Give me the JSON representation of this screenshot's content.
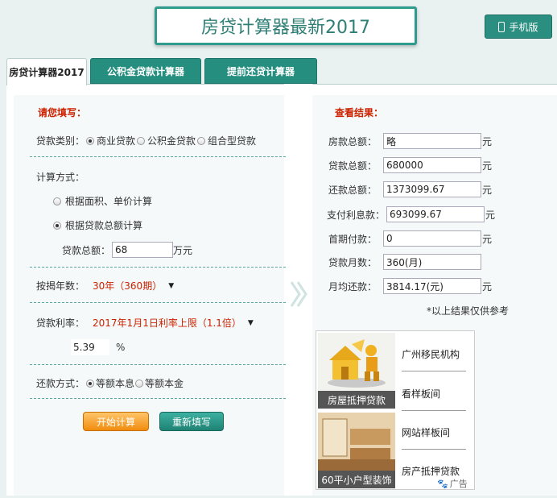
{
  "header": {
    "title": "房贷计算器最新2017",
    "mobile_label": "手机版"
  },
  "tabs": [
    "房贷计算器2017",
    "公积金贷款计算器",
    "提前还贷计算器"
  ],
  "form": {
    "heading": "请您填写：",
    "loan_type_label": "贷款类别：",
    "loan_types": [
      "商业贷款",
      "公积金贷款",
      "组合型贷款"
    ],
    "calc_method_label": "计算方式：",
    "calc_methods": [
      "根据面积、单价计算",
      "根据贷款总额计算"
    ],
    "loan_total_label": "贷款总额：",
    "loan_total_value": "68",
    "loan_total_unit": "万元",
    "years_label": "按揭年数：",
    "years_value": "30年（360期）",
    "rate_label": "贷款利率：",
    "rate_value": "2017年1月1日利率上限（1.1倍）",
    "rate_number": "5.39",
    "rate_unit": "%",
    "repay_label": "还款方式：",
    "repay_methods": [
      "等额本息",
      "等额本金"
    ],
    "start_btn": "开始计算",
    "reset_btn": "重新填写"
  },
  "results": {
    "heading": "查看结果：",
    "rows": [
      {
        "label": "房款总额：",
        "value": "略",
        "unit": "元"
      },
      {
        "label": "贷款总额：",
        "value": "680000",
        "unit": "元"
      },
      {
        "label": "还款总额：",
        "value": "1373099.67",
        "unit": "元"
      },
      {
        "label": "支付利息款：",
        "value": "693099.67",
        "unit": "元"
      },
      {
        "label": "首期付款：",
        "value": "0",
        "unit": "元"
      },
      {
        "label": "贷款月数：",
        "value": "360(月)",
        "unit": ""
      },
      {
        "label": "月均还款：",
        "value": "3814.17(元)",
        "unit": "元"
      }
    ],
    "note": "*以上结果仅供参考"
  },
  "ad": {
    "img1_caption": "房屋抵押贷款",
    "img2_caption": "60平小户型装饰",
    "links": [
      "广州移民机构",
      "看样板间",
      "网站样板间",
      "房产抵押贷款"
    ],
    "badge": "广告"
  }
}
